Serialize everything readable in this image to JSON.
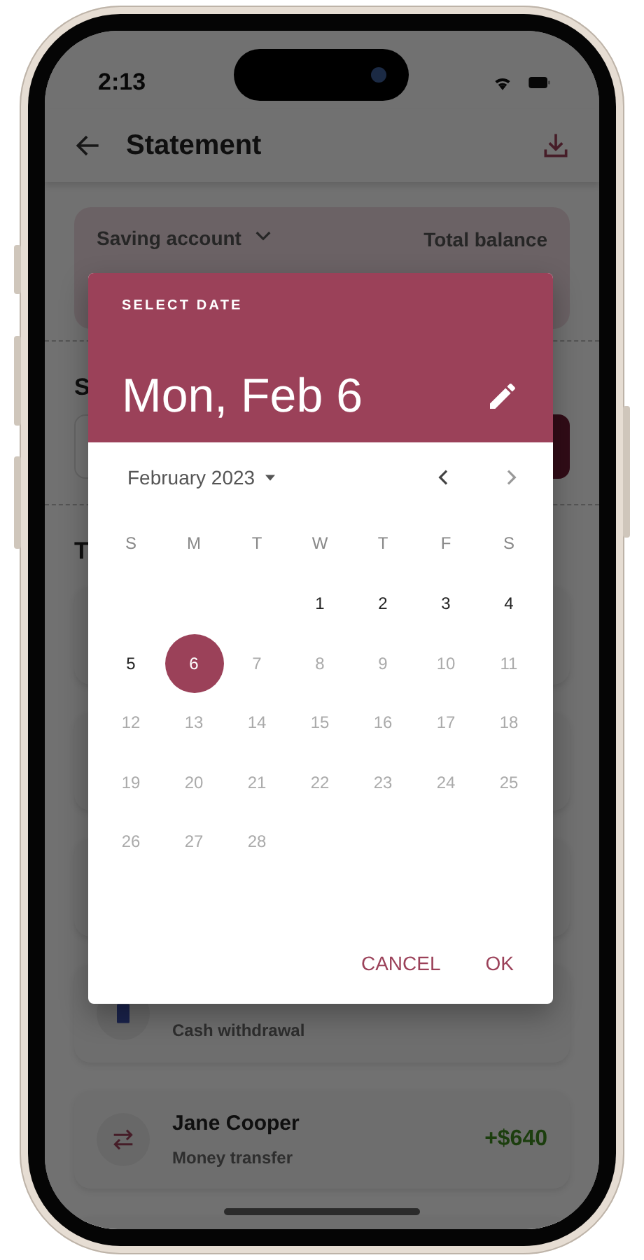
{
  "status_bar": {
    "time": "2:13"
  },
  "app_bar": {
    "title": "Statement"
  },
  "account_card": {
    "account_label": "Saving account",
    "balance_label": "Total balance"
  },
  "filter_section": {
    "title": "S"
  },
  "transactions": {
    "title": "T",
    "items": [
      {
        "kind": "withdrawal",
        "subtitle": "Cash withdrawal"
      },
      {
        "kind": "transfer",
        "name": "Jane Cooper",
        "subtitle": "Money transfer",
        "amount": "+$640"
      }
    ]
  },
  "date_dialog": {
    "header_label": "SELECT DATE",
    "selected_date": "Mon, Feb 6",
    "month_label": "February 2023",
    "weekdays": [
      "S",
      "M",
      "T",
      "W",
      "T",
      "F",
      "S"
    ],
    "weeks": [
      {
        "starts_midweek": true,
        "days": [
          {
            "day": "1",
            "selected": false,
            "disabled": false
          },
          {
            "day": "2",
            "selected": false,
            "disabled": false
          },
          {
            "day": "3",
            "selected": false,
            "disabled": false
          },
          {
            "day": "4",
            "selected": false,
            "disabled": false
          }
        ]
      },
      {
        "starts_midweek": false,
        "days": [
          {
            "day": "5",
            "selected": false,
            "disabled": false
          },
          {
            "day": "6",
            "selected": true,
            "disabled": false
          },
          {
            "day": "7",
            "selected": false,
            "disabled": true
          },
          {
            "day": "8",
            "selected": false,
            "disabled": true
          },
          {
            "day": "9",
            "selected": false,
            "disabled": true
          },
          {
            "day": "10",
            "selected": false,
            "disabled": true
          },
          {
            "day": "11",
            "selected": false,
            "disabled": true
          }
        ]
      },
      {
        "starts_midweek": false,
        "days": [
          {
            "day": "12",
            "selected": false,
            "disabled": true
          },
          {
            "day": "13",
            "selected": false,
            "disabled": true
          },
          {
            "day": "14",
            "selected": false,
            "disabled": true
          },
          {
            "day": "15",
            "selected": false,
            "disabled": true
          },
          {
            "day": "16",
            "selected": false,
            "disabled": true
          },
          {
            "day": "17",
            "selected": false,
            "disabled": true
          },
          {
            "day": "18",
            "selected": false,
            "disabled": true
          }
        ]
      },
      {
        "starts_midweek": false,
        "days": [
          {
            "day": "19",
            "selected": false,
            "disabled": true
          },
          {
            "day": "20",
            "selected": false,
            "disabled": true
          },
          {
            "day": "21",
            "selected": false,
            "disabled": true
          },
          {
            "day": "22",
            "selected": false,
            "disabled": true
          },
          {
            "day": "23",
            "selected": false,
            "disabled": true
          },
          {
            "day": "24",
            "selected": false,
            "disabled": true
          },
          {
            "day": "25",
            "selected": false,
            "disabled": true
          }
        ]
      },
      {
        "starts_midweek": false,
        "days": [
          {
            "day": "26",
            "selected": false,
            "disabled": true
          },
          {
            "day": "27",
            "selected": false,
            "disabled": true
          },
          {
            "day": "28",
            "selected": false,
            "disabled": true
          }
        ]
      }
    ],
    "buttons": [
      {
        "label": "CANCEL"
      },
      {
        "label": "OK"
      }
    ]
  }
}
